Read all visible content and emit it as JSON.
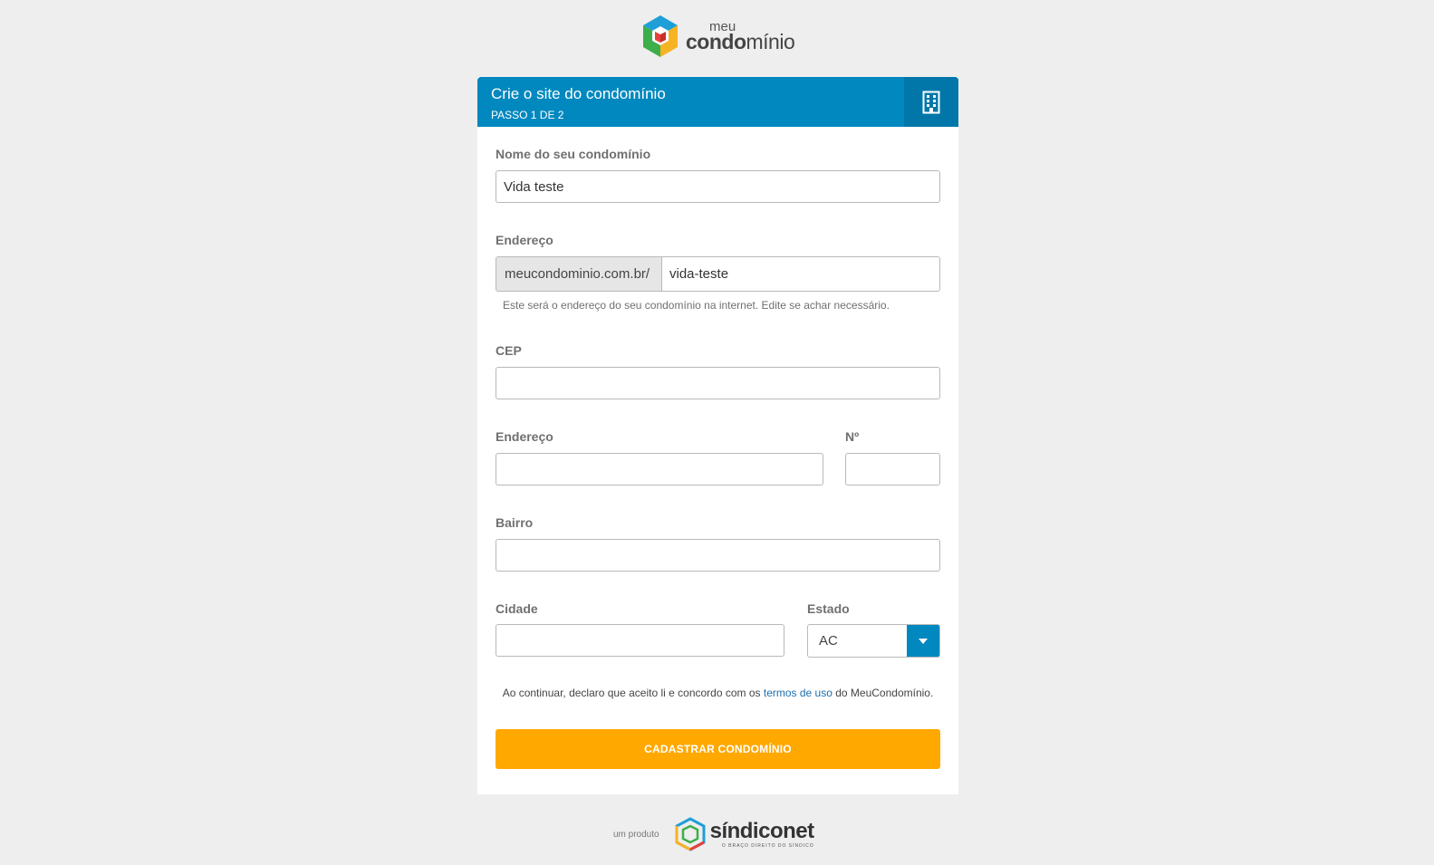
{
  "logo": {
    "meu": "meu",
    "condo_bold": "condo",
    "condo_light": "mínio"
  },
  "header": {
    "title": "Crie o site do condomínio",
    "step": "PASSO 1 DE 2",
    "icon": "building-icon"
  },
  "form": {
    "nome_label": "Nome do seu condomínio",
    "nome_value": "Vida teste",
    "endereco_site_label": "Endereço",
    "endereco_site_prefix": "meucondominio.com.br/",
    "endereco_site_value": "vida-teste",
    "endereco_site_help": "Este será o endereço do seu condomínio na internet. Edite se achar necessário.",
    "cep_label": "CEP",
    "cep_value": "",
    "endereco_label": "Endereço",
    "endereco_value": "",
    "numero_label": "Nº",
    "numero_value": "",
    "bairro_label": "Bairro",
    "bairro_value": "",
    "cidade_label": "Cidade",
    "cidade_value": "",
    "estado_label": "Estado",
    "estado_value": "AC"
  },
  "terms": {
    "before": "Ao continuar, declaro que aceito li e concordo com os ",
    "link": "termos de uso",
    "after": " do MeuCondomínio."
  },
  "submit_label": "CADASTRAR CONDOMÍNIO",
  "footer": {
    "pre": "um produto",
    "brand": "síndiconet",
    "tagline": "O BRAÇO DIREITO DO SÍNDICO"
  },
  "colors": {
    "primary": "#0088bf",
    "accent": "#ffa800",
    "background": "#eeeeee"
  }
}
